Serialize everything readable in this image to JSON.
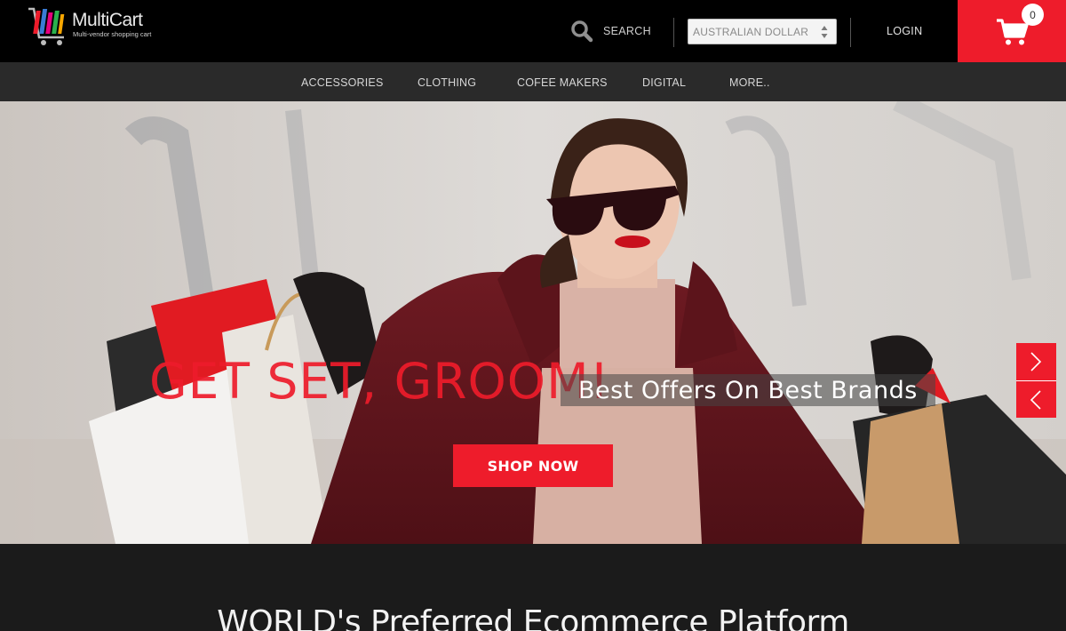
{
  "header": {
    "logo_text": "MultiCart",
    "logo_tagline": "Multi-vendor shopping cart",
    "search_label": "SEARCH",
    "search_icon": "search-icon",
    "currency_selected": "AUSTRALIAN DOLLAR",
    "login_label": "LOGIN",
    "cart_icon": "cart-icon",
    "cart_count": "0"
  },
  "nav": {
    "items": [
      {
        "label": "ACCESSORIES"
      },
      {
        "label": "CLOTHING"
      },
      {
        "label": "COFEE MAKERS"
      },
      {
        "label": "DIGITAL"
      },
      {
        "label": "MORE.."
      }
    ]
  },
  "hero": {
    "title": "GET SET, GROOM!",
    "subtitle": "Best Offers On Best Brands",
    "cta_label": "SHOP NOW",
    "next_icon": "chevron-right-icon",
    "prev_icon": "chevron-left-icon"
  },
  "section": {
    "tagline": "WORLD's Preferred Ecommerce Platform"
  },
  "colors": {
    "accent": "#ee1c2b",
    "header_bg": "#000000",
    "nav_bg": "#2a2a2a",
    "page_bg": "#1b1b1b"
  }
}
